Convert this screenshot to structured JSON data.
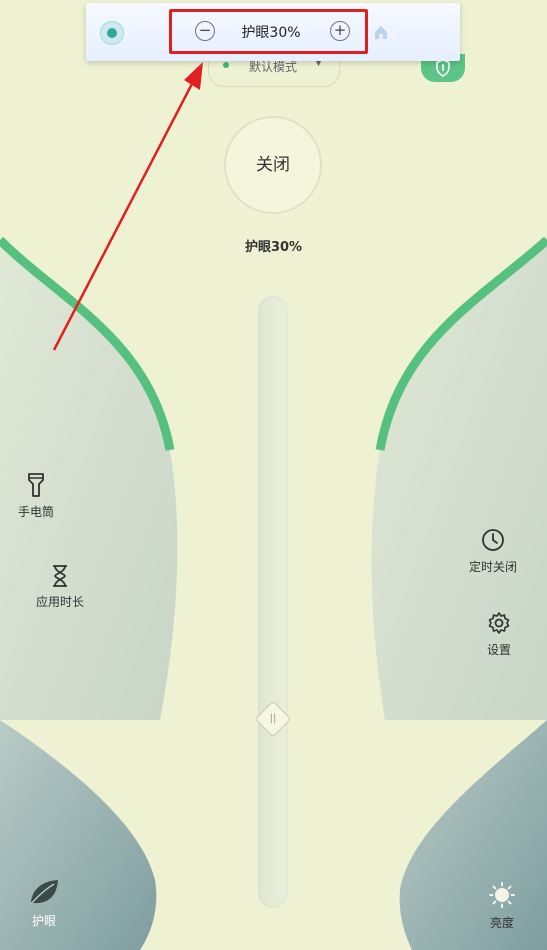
{
  "toolbar": {
    "label": "护眼30%",
    "minus": "−",
    "plus": "+"
  },
  "mode": {
    "label": "默认模式",
    "caret": "▼"
  },
  "power": {
    "label": "关闭"
  },
  "status": {
    "text": "护眼30%"
  },
  "slider": {
    "grip": "||",
    "level_fraction": 0.3
  },
  "left_tools": [
    {
      "label": "手电筒",
      "icon": "flashlight-icon"
    },
    {
      "label": "应用时长",
      "icon": "hourglass-icon"
    }
  ],
  "right_tools": [
    {
      "label": "定时关闭",
      "icon": "clock-icon"
    },
    {
      "label": "设置",
      "icon": "gear-icon"
    }
  ],
  "bottom": {
    "left_label": "护眼",
    "right_label": "亮度"
  },
  "colors": {
    "background": "#eef2d2",
    "accent_green": "#5cc487",
    "highlight_red": "#e02020"
  }
}
